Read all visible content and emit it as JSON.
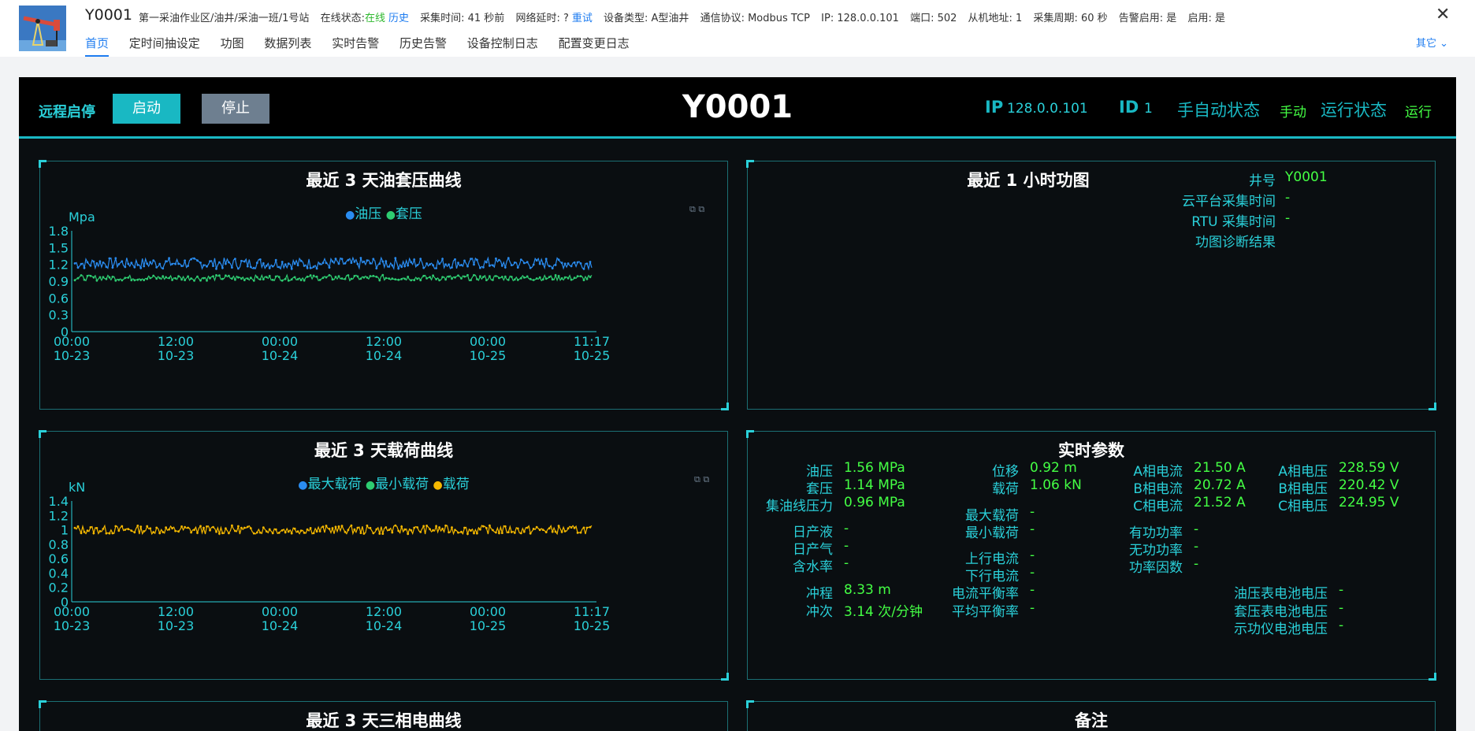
{
  "header": {
    "title": "Y0001",
    "path": "第一采油作业区/油井/采油一班/1号站",
    "online_label": "在线状态:",
    "online_value": "在线",
    "history_link": "历史",
    "collect_time": "采集时间: 41 秒前",
    "net_delay_label": "网络延时: ?",
    "retry_link": "重试",
    "device_type": "设备类型: A型油井",
    "protocol": "通信协议: Modbus TCP",
    "ip": "IP: 128.0.0.101",
    "port": "端口: 502",
    "slave": "从机地址: 1",
    "period": "采集周期: 60 秒",
    "alarm_enabled": "告警启用: 是",
    "enabled": "启用: 是",
    "close_icon": "close-icon",
    "more_label": "其它",
    "tabs": [
      "首页",
      "定时间抽设定",
      "功图",
      "数据列表",
      "实时告警",
      "历史告警",
      "设备控制日志",
      "配置变更日志"
    ],
    "active_tab": 0
  },
  "control_bar": {
    "remote_label": "远程启停",
    "start_label": "启动",
    "stop_label": "停止",
    "well_id": "Y0001",
    "ip_label": "IP",
    "ip_value": "128.0.0.101",
    "id_label": "ID",
    "id_value": "1",
    "mode_label": "手自动状态",
    "mode_value": "手动",
    "run_label": "运行状态",
    "run_value": "运行"
  },
  "colors": {
    "accent": "#19b8c3",
    "blue": "#2a8cf0",
    "green": "#2ecc71",
    "yellow": "#f5b800",
    "value_green": "#44ff44"
  },
  "chart_data": [
    {
      "type": "line",
      "title": "最近 3 天油套压曲线",
      "ylabel": "Mpa",
      "ylim": [
        0,
        1.8
      ],
      "yticks": [
        "1.8",
        "1.5",
        "1.2",
        "0.9",
        "0.6",
        "0.3",
        "0"
      ],
      "xticks": [
        [
          "00:00",
          "10-23"
        ],
        [
          "12:00",
          "10-23"
        ],
        [
          "00:00",
          "10-24"
        ],
        [
          "12:00",
          "10-24"
        ],
        [
          "00:00",
          "10-25"
        ],
        [
          "11:17",
          "10-25"
        ]
      ],
      "legend": "top-center",
      "series": [
        {
          "name": "油压",
          "color": "#2a8cf0",
          "mean": 1.22,
          "amplitude": 0.1
        },
        {
          "name": "套压",
          "color": "#2ecc71",
          "mean": 0.96,
          "amplitude": 0.05
        }
      ]
    },
    {
      "type": "line",
      "title": "最近 3 天载荷曲线",
      "ylabel": "kN",
      "ylim": [
        0,
        1.4
      ],
      "yticks": [
        "1.4",
        "1.2",
        "1",
        "0.8",
        "0.6",
        "0.4",
        "0.2",
        "0"
      ],
      "xticks": [
        [
          "00:00",
          "10-23"
        ],
        [
          "12:00",
          "10-23"
        ],
        [
          "00:00",
          "10-24"
        ],
        [
          "12:00",
          "10-24"
        ],
        [
          "00:00",
          "10-25"
        ],
        [
          "11:17",
          "10-25"
        ]
      ],
      "legend": "top-center",
      "series": [
        {
          "name": "最大载荷",
          "color": "#2a8cf0"
        },
        {
          "name": "最小载荷",
          "color": "#2ecc71"
        },
        {
          "name": "载荷",
          "color": "#f5b800",
          "mean": 1.0,
          "amplitude": 0.06
        }
      ]
    }
  ],
  "card_panel": {
    "title": "最近 1 小时功图",
    "rows": [
      {
        "k": "井号",
        "v": "Y0001"
      },
      {
        "k": "云平台采集时间",
        "v": "-"
      },
      {
        "k": "RTU 采集时间",
        "v": "-"
      },
      {
        "k": "功图诊断结果",
        "v": ""
      }
    ]
  },
  "realtime": {
    "title": "实时参数",
    "col1": [
      {
        "k": "油压",
        "v": "1.56 MPa"
      },
      {
        "k": "套压",
        "v": "1.14 MPa"
      },
      {
        "k": "集油线压力",
        "v": "0.96 MPa"
      },
      {
        "k": "日产液",
        "v": "-"
      },
      {
        "k": "日产气",
        "v": "-"
      },
      {
        "k": "含水率",
        "v": "-"
      },
      {
        "k": "冲程",
        "v": "8.33 m"
      },
      {
        "k": "冲次",
        "v": "3.14 次/分钟"
      }
    ],
    "col2": [
      {
        "k": "位移",
        "v": "0.92 m"
      },
      {
        "k": "载荷",
        "v": "1.06 kN"
      },
      {
        "k": "最大载荷",
        "v": "-"
      },
      {
        "k": "最小载荷",
        "v": "-"
      },
      {
        "k": "上行电流",
        "v": "-"
      },
      {
        "k": "下行电流",
        "v": "-"
      },
      {
        "k": "电流平衡率",
        "v": "-"
      },
      {
        "k": "平均平衡率",
        "v": "-"
      }
    ],
    "col3": [
      {
        "k": "A相电流",
        "v": "21.50 A"
      },
      {
        "k": "B相电流",
        "v": "20.72 A"
      },
      {
        "k": "C相电流",
        "v": "21.52 A"
      },
      {
        "k": "有功功率",
        "v": "-"
      },
      {
        "k": "无功功率",
        "v": "-"
      },
      {
        "k": "功率因数",
        "v": "-"
      }
    ],
    "col4": [
      {
        "k": "A相电压",
        "v": "228.59 V"
      },
      {
        "k": "B相电压",
        "v": "220.42 V"
      },
      {
        "k": "C相电压",
        "v": "224.95 V"
      },
      {
        "k": "油压表电池电压",
        "v": "-"
      },
      {
        "k": "套压表电池电压",
        "v": "-"
      },
      {
        "k": "示功仪电池电压",
        "v": "-"
      }
    ]
  },
  "bottom_panels": {
    "power_title": "最近 3 天三相电曲线",
    "notes_title": "备注"
  }
}
